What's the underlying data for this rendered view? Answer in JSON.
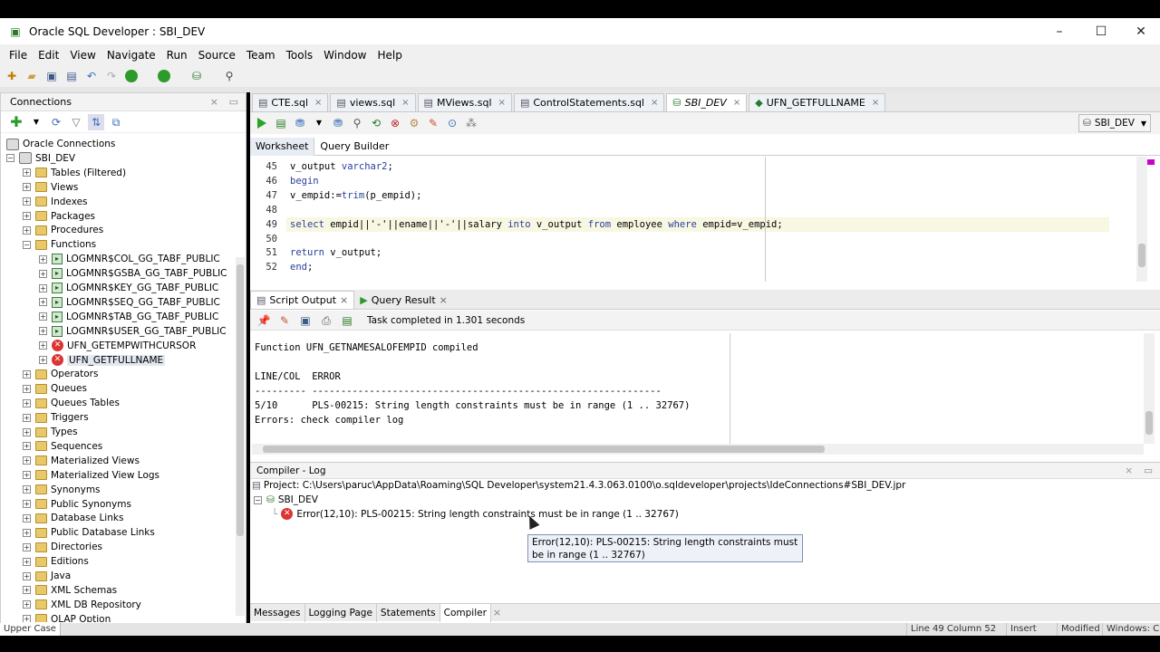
{
  "window": {
    "title": "Oracle SQL Developer : SBI_DEV",
    "minimize": "–",
    "maximize": "☐",
    "close": "✕"
  },
  "menu": [
    "File",
    "Edit",
    "View",
    "Navigate",
    "Run",
    "Source",
    "Team",
    "Tools",
    "Window",
    "Help"
  ],
  "connections": {
    "title": "Connections",
    "close": "×",
    "items": [
      {
        "label": "Oracle Connections",
        "icon": "database-icon",
        "level": 0,
        "expander": ""
      },
      {
        "label": "SBI_DEV",
        "icon": "connection-icon",
        "level": 1,
        "expander": "−"
      },
      {
        "label": "Tables (Filtered)",
        "icon": "folder-icon",
        "level": 2,
        "expander": "+"
      },
      {
        "label": "Views",
        "icon": "folder-icon",
        "level": 2,
        "expander": "+"
      },
      {
        "label": "Indexes",
        "icon": "folder-icon",
        "level": 2,
        "expander": "+"
      },
      {
        "label": "Packages",
        "icon": "folder-icon",
        "level": 2,
        "expander": "+"
      },
      {
        "label": "Procedures",
        "icon": "folder-icon",
        "level": 2,
        "expander": "+"
      },
      {
        "label": "Functions",
        "icon": "folder-icon",
        "level": 2,
        "expander": "−"
      },
      {
        "label": "LOGMNR$COL_GG_TABF_PUBLIC",
        "icon": "function-icon",
        "level": 3,
        "expander": "+"
      },
      {
        "label": "LOGMNR$GSBA_GG_TABF_PUBLIC",
        "icon": "function-icon",
        "level": 3,
        "expander": "+"
      },
      {
        "label": "LOGMNR$KEY_GG_TABF_PUBLIC",
        "icon": "function-icon",
        "level": 3,
        "expander": "+"
      },
      {
        "label": "LOGMNR$SEQ_GG_TABF_PUBLIC",
        "icon": "function-icon",
        "level": 3,
        "expander": "+"
      },
      {
        "label": "LOGMNR$TAB_GG_TABF_PUBLIC",
        "icon": "function-icon",
        "level": 3,
        "expander": "+"
      },
      {
        "label": "LOGMNR$USER_GG_TABF_PUBLIC",
        "icon": "function-icon",
        "level": 3,
        "expander": "+"
      },
      {
        "label": "UFN_GETEMPWITHCURSOR",
        "icon": "error-function-icon",
        "level": 3,
        "expander": "+"
      },
      {
        "label": "UFN_GETFULLNAME",
        "icon": "error-function-icon",
        "level": 3,
        "expander": "+"
      },
      {
        "label": "Operators",
        "icon": "folder-icon",
        "level": 2,
        "expander": "+"
      },
      {
        "label": "Queues",
        "icon": "folder-icon",
        "level": 2,
        "expander": "+"
      },
      {
        "label": "Queues Tables",
        "icon": "folder-icon",
        "level": 2,
        "expander": "+"
      },
      {
        "label": "Triggers",
        "icon": "folder-icon",
        "level": 2,
        "expander": "+"
      },
      {
        "label": "Types",
        "icon": "folder-icon",
        "level": 2,
        "expander": "+"
      },
      {
        "label": "Sequences",
        "icon": "folder-icon",
        "level": 2,
        "expander": "+"
      },
      {
        "label": "Materialized Views",
        "icon": "folder-icon",
        "level": 2,
        "expander": "+"
      },
      {
        "label": "Materialized View Logs",
        "icon": "folder-icon",
        "level": 2,
        "expander": "+"
      },
      {
        "label": "Synonyms",
        "icon": "folder-icon",
        "level": 2,
        "expander": "+"
      },
      {
        "label": "Public Synonyms",
        "icon": "folder-icon",
        "level": 2,
        "expander": "+"
      },
      {
        "label": "Database Links",
        "icon": "folder-icon",
        "level": 2,
        "expander": "+"
      },
      {
        "label": "Public Database Links",
        "icon": "folder-icon",
        "level": 2,
        "expander": "+"
      },
      {
        "label": "Directories",
        "icon": "folder-icon",
        "level": 2,
        "expander": "+"
      },
      {
        "label": "Editions",
        "icon": "folder-icon",
        "level": 2,
        "expander": "+"
      },
      {
        "label": "Java",
        "icon": "folder-icon",
        "level": 2,
        "expander": "+"
      },
      {
        "label": "XML Schemas",
        "icon": "folder-icon",
        "level": 2,
        "expander": "+"
      },
      {
        "label": "XML DB Repository",
        "icon": "folder-icon",
        "level": 2,
        "expander": "+"
      },
      {
        "label": "OLAP Option",
        "icon": "folder-icon",
        "level": 2,
        "expander": "+"
      }
    ]
  },
  "editor_tabs": [
    {
      "label": "CTE.sql",
      "active": false
    },
    {
      "label": "views.sql",
      "active": false
    },
    {
      "label": "MViews.sql",
      "active": false
    },
    {
      "label": "ControlStatements.sql",
      "active": false
    },
    {
      "label": "SBI_DEV",
      "active": true
    },
    {
      "label": "UFN_GETFULLNAME",
      "active": false
    }
  ],
  "connection_selector": "SBI_DEV",
  "worksheet_tabs": [
    "Worksheet",
    "Query Builder"
  ],
  "editor": {
    "lines": [
      {
        "num": "45",
        "text": "v_output varchar2;"
      },
      {
        "num": "46",
        "text": "begin"
      },
      {
        "num": "47",
        "text": "v_empid:=trim(p_empid);"
      },
      {
        "num": "48",
        "text": ""
      },
      {
        "num": "49",
        "text": "select empid||'-'||ename||'-'||salary into v_output from employee where empid=v_empid;"
      },
      {
        "num": "50",
        "text": ""
      },
      {
        "num": "51",
        "text": "return v_output;"
      },
      {
        "num": "52",
        "text": "end;"
      }
    ]
  },
  "output_tabs": [
    {
      "label": "Script Output",
      "close": "×"
    },
    {
      "label": "Query Result",
      "close": "×"
    }
  ],
  "output": {
    "status": "Task completed in 1.301 seconds",
    "lines": [
      "Function UFN_GETNAMESALOFEMPID compiled",
      "",
      "LINE/COL  ERROR",
      "--------- -------------------------------------------------------------",
      "5/10      PLS-00215: String length constraints must be in range (1 .. 32767)",
      "Errors: check compiler log"
    ]
  },
  "compiler_log": {
    "title": "Compiler - Log",
    "project": "Project: C:\\Users\\paruc\\AppData\\Roaming\\SQL Developer\\system21.4.3.063.0100\\o.sqldeveloper\\projects\\IdeConnections#SBI_DEV.jpr",
    "connection": "SBI_DEV",
    "error": "Error(12,10): PLS-00215: String length constraints must be in range (1 .. 32767)",
    "tooltip": "Error(12,10): PLS-00215: String length constraints must be in range (1 .. 32767)"
  },
  "bottom_tabs": [
    "Messages",
    "Logging Page",
    "Statements",
    "Compiler"
  ],
  "status": {
    "left": "Upper Case",
    "position": "Line 49 Column 52",
    "mode": "Insert",
    "modified": "Modified",
    "os": "Windows: CR"
  }
}
